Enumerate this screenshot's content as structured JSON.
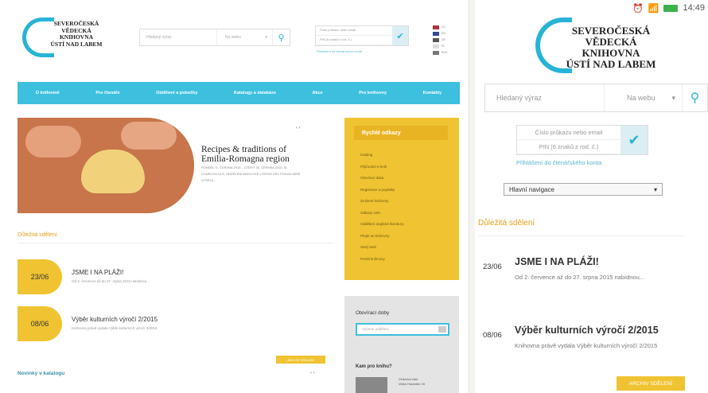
{
  "desktop": {
    "logo": [
      "SEVEROČESKÁ",
      "VĚDECKÁ",
      "KNIHOVNA",
      "ÚSTÍ NAD LABEM"
    ],
    "search": {
      "placeholder": "Hledaný výraz",
      "scope": "Na webu"
    },
    "login": {
      "card": "Číslo průkazu nebo email",
      "pin": "PIN (6 znaků z rod. č.)",
      "link": "Přihlášení do čtenářského konta"
    },
    "langs": [
      "CZ",
      "EN",
      "DE",
      "PL",
      "RUS"
    ],
    "nav": [
      "O knihovně",
      "Pro čtenáře",
      "Oddělení a pobočky",
      "Katalogy a databáze",
      "Akce",
      "Pro knihovny",
      "Kontakty"
    ],
    "hero": {
      "controls": "‹ ›",
      "title": "Recipes & traditions of Emilia-Romagna region",
      "desc": "Pondělí 1. června 2015 – úterý 30. června 2015, M. Churchilla 5, Oddělení anglické literatury pokud není vyšší a..."
    },
    "quick": {
      "heading": "Rychlé odkazy",
      "links": [
        "Katalog",
        "Půjčování e-knih",
        "Otevírací doba",
        "Registrace a poplatky",
        "Zrušené knihovny",
        "Odkazy web",
        "Oddělení anglické literatury",
        "Ptejte se knihovny",
        "Starý web",
        "Portál knihovny"
      ]
    },
    "important": "Důležitá sdělení",
    "news": [
      {
        "date": "23/06",
        "title": "JSME I NA PLÁŽI!",
        "summary": "Od 2. července  až do 27. srpna  2015  nabídnou..."
      },
      {
        "date": "08/06",
        "title": "Výběr kulturních výročí 2/2015",
        "summary": "Knihovna právě vydala Výběr kulturních výročí 2/2015"
      }
    ],
    "hours": {
      "heading": "Otevírací doby",
      "select": "Vyberte oddělení",
      "where": "Kam pro knihu?",
      "branch": "Vědecká část",
      "address": "Velká Hradební 49"
    },
    "archive": "ARCHIV SDĚLENÍ",
    "novinky": "Novinky v katalogu",
    "novinky_controls": "‹ ›"
  },
  "mobile": {
    "time": "14:49",
    "logo": [
      "SEVEROČESKÁ",
      "VĚDECKÁ",
      "KNIHOVNA",
      "ÚSTÍ NAD LABEM"
    ],
    "search": {
      "placeholder": "Hledaný výraz",
      "scope": "Na webu"
    },
    "login": {
      "card": "Číslo průkazu nebo email",
      "pin": "PIN (6 znaků z rod. č.)",
      "link": "Přihlášení do čtenářského konta"
    },
    "nav_select": "Hlavní navigace",
    "important": "Důležitá sdělení",
    "news": [
      {
        "date": "23/06",
        "title": "JSME I NA PLÁŽI!",
        "summary": "Od 2. července  až do 27. srpna  2015  nabídnou..."
      },
      {
        "date": "08/06",
        "title": "Výběr kulturních výročí 2/2015",
        "summary": "Knihovna právě vydala Výběr kulturních výročí 2/2015"
      }
    ],
    "archive": "ARCHIV SDĚLENÍ"
  },
  "colors": {
    "accent": "#3cc0de",
    "yellow": "#f0c332",
    "orange_text": "#e2a11f"
  }
}
